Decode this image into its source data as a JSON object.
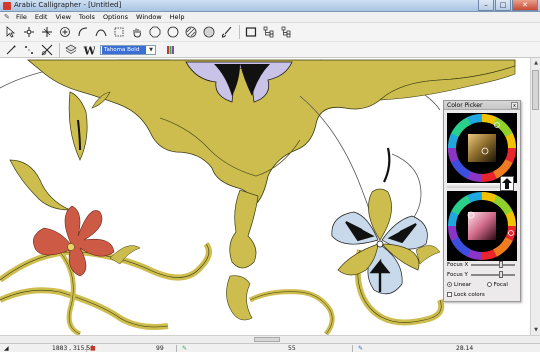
{
  "window": {
    "title": "Arabic Calligrapher - [Untitled]",
    "minimize_label": "–",
    "maximize_label": "□",
    "close_label": "✕"
  },
  "menu": [
    {
      "label": "File"
    },
    {
      "label": "Edit"
    },
    {
      "label": "View"
    },
    {
      "label": "Tools"
    },
    {
      "label": "Options"
    },
    {
      "label": "Window"
    },
    {
      "label": "Help"
    }
  ],
  "toolbar1": {
    "icons": [
      "pointer-icon",
      "node-edit-icon",
      "transform-icon",
      "add-point-icon",
      "curve-icon",
      "bezier-icon",
      "select-rect-icon",
      "pan-hand-icon",
      "octagon-icon",
      "circle-icon",
      "hatch-circle-icon",
      "fill-circle-icon",
      "brush-icon",
      "frame-icon",
      "tree-link-icon",
      "tree-link2-icon"
    ]
  },
  "toolbar2": {
    "font_select_value": "Tahoma Bold",
    "icons": [
      "arc-tool-icon",
      "dots-tool-icon",
      "cut-tool-icon",
      "layers-icon",
      "text-w-icon",
      "palette-icon"
    ]
  },
  "colors": {
    "ornament": "#cdbd4e",
    "ornament_dark": "#7c7a2f",
    "petal_blue": "#c7d9ea",
    "flower_red": "#cc5a45",
    "lavender": "#c9c3e8"
  },
  "status": {
    "coords": "1883 , 315.56",
    "field2": "99",
    "field3": "55",
    "field4": "28.14"
  },
  "color_picker": {
    "title": "Color Picker",
    "close_label": "x",
    "focus_x_label": "Focus X",
    "focus_y_label": "Focus Y",
    "linear_label": "Linear",
    "focal_label": "Focal",
    "lock_label": "Lock colors"
  }
}
